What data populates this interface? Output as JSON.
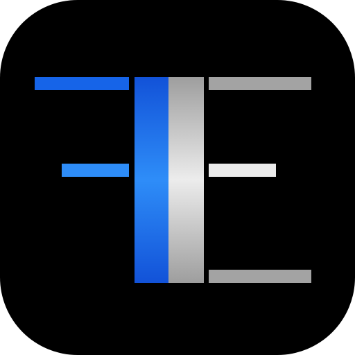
{
  "icon": {
    "glyph": "FE-monogram-icon",
    "colors": {
      "background": "#000000",
      "blue_dark": "#1252D8",
      "blue_mid": "#1664E8",
      "blue_light": "#2E8DF8",
      "gray_dark": "#9E9E9E",
      "gray_light": "#ECECEC",
      "gray_bar": "#A3A3A3"
    }
  }
}
